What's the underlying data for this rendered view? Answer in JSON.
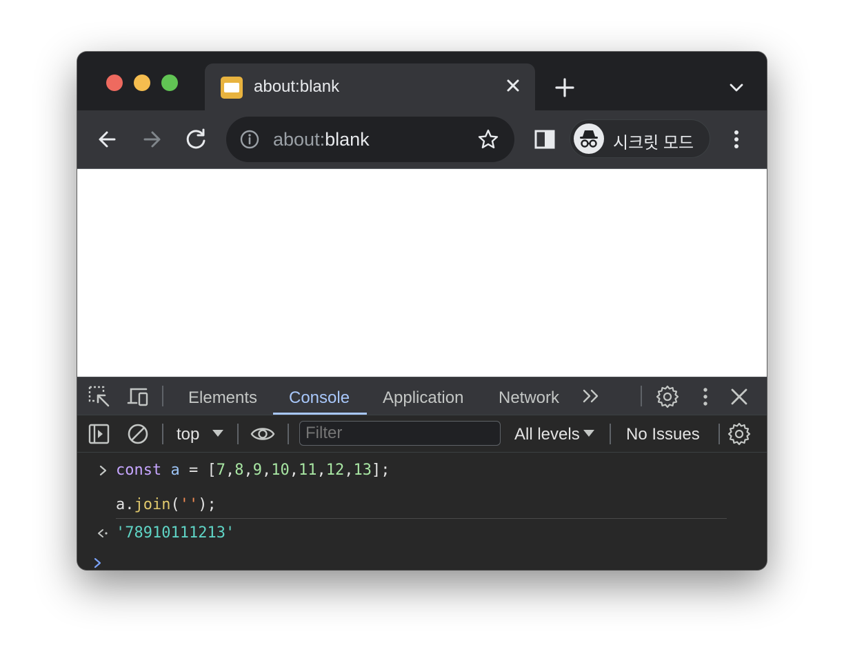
{
  "browser": {
    "tab": {
      "title": "about:blank"
    },
    "omnibox": {
      "scheme": "about:",
      "host": "blank"
    },
    "incognito_label": "시크릿 모드"
  },
  "devtools": {
    "tabs": [
      "Elements",
      "Console",
      "Application",
      "Network"
    ],
    "active_tab": "Console",
    "console_toolbar": {
      "context": "top",
      "filter_placeholder": "Filter",
      "levels": "All levels",
      "issues": "No Issues"
    },
    "console": {
      "input_line1": {
        "keyword": "const",
        "name": "a",
        "eq": "=",
        "open": "[",
        "numbers": [
          "7",
          "8",
          "9",
          "10",
          "11",
          "12",
          "13"
        ],
        "close": "];"
      },
      "input_line2": {
        "obj": "a.",
        "method": "join",
        "open": "(",
        "arg": "''",
        "close": ");"
      },
      "result": "'78910111213'"
    }
  }
}
